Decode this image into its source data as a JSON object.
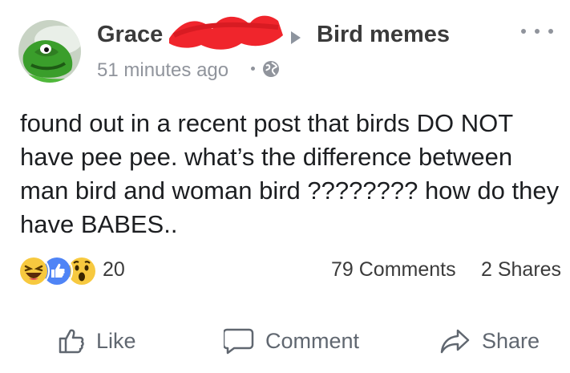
{
  "post": {
    "author": "Grace",
    "group": "Bird memes",
    "timestamp": "51 minutes ago",
    "privacy_icon": "globe-icon",
    "more_icon": "ellipsis-icon",
    "text": "found out in a recent post that birds DO NOT have pee pee. what’s the difference between man bird and woman bird ???????? how do they have BABES.."
  },
  "stats": {
    "reactions": [
      "haha",
      "like",
      "wow"
    ],
    "reaction_count": "20",
    "comments": "79 Comments",
    "shares": "2 Shares"
  },
  "actions": {
    "like": "Like",
    "comment": "Comment",
    "share": "Share"
  },
  "colors": {
    "like_blue": "#4267b2",
    "reaction_yellow": "#f7c93f",
    "redaction_red": "#f0252c",
    "muted_gray": "#90949c"
  }
}
